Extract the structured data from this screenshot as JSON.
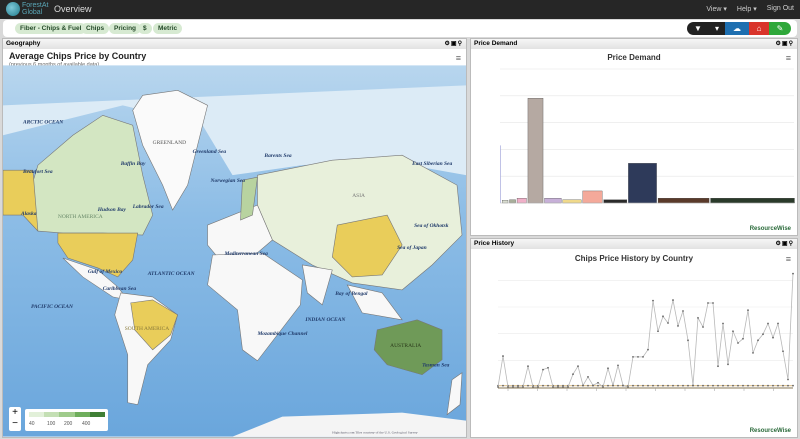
{
  "app": {
    "logo_text": "ForestAt Global",
    "title": "Overview"
  },
  "nav": {
    "view": "View ▾",
    "help": "Help ▾",
    "signout": "Sign Out"
  },
  "filters": [
    "Fiber - Chips & Fuel",
    "Chips",
    "Pricing",
    "$",
    "Metric"
  ],
  "toolbar": {
    "icons": [
      "filter-icon",
      "dropdown-icon",
      "cloud-download-icon",
      "home-icon",
      "pencil-icon"
    ],
    "colors": [
      "#222222",
      "#222222",
      "#1e6fb0",
      "#d9342b",
      "#2fa83a"
    ]
  },
  "geography": {
    "panel_label": "Geography",
    "title": "Average Chips Price by Country",
    "subtitle": "(previous 6 months of available data)",
    "legend": {
      "ticks": [
        "40",
        "100",
        "200",
        "400"
      ],
      "colors": [
        "#e2f0d9",
        "#c4dfb4",
        "#9fcb8b",
        "#6fae5c",
        "#3f7f35"
      ]
    },
    "attribution": "Highcharts.com Tiles courtesy of the U.S. Geological Survey",
    "zoom_in": "+",
    "zoom_out": "−",
    "highlight_colors": {
      "low": "#e9cd5a",
      "mid": "#c9e0b4",
      "high": "#6f9a58"
    },
    "labels": {
      "arctic": "ARCTIC OCEAN",
      "greenland": "GREENLAND",
      "greenland_sea": "Greenland Sea",
      "baffin": "Baffin Bay",
      "barents": "Barents Sea",
      "norwegian": "Norwegian Sea",
      "beaufort": "Beaufort Sea",
      "labrador": "Labrador Sea",
      "hudson": "Hudson Bay",
      "north_america": "NORTH AMERICA",
      "alaska": "Alaska",
      "asia": "ASIA",
      "east_siberian": "East Siberian Sea",
      "okhotsk": "Sea of Okhotsk",
      "japan": "Sea of Japan",
      "atlantic": "ATLANTIC OCEAN",
      "gulf": "Gulf of Mexico",
      "caribbean": "Caribbean Sea",
      "pacific": "PACIFIC OCEAN",
      "south_america": "SOUTH AMERICA",
      "mediterranean": "Mediterranean Sea",
      "bengal": "Bay of Bengal",
      "indian": "INDIAN OCEAN",
      "mozambique": "Mozambique Channel",
      "australia": "AUSTRALIA",
      "tasman": "Tasman Sea"
    }
  },
  "price_demand": {
    "panel_label": "Price Demand",
    "brand": "ResourceWise"
  },
  "price_history": {
    "panel_label": "Price History",
    "brand": "ResourceWise"
  },
  "chart_data": [
    {
      "type": "bar",
      "variant": "variwide",
      "title": "Price Demand",
      "ylim": [
        0,
        5
      ],
      "grid": true,
      "values": [
        2.15,
        0.1,
        0.12,
        0.18,
        3.91,
        0.18,
        0.12,
        0.45,
        0.12,
        1.48,
        0.18,
        0.18
      ],
      "widths": [
        1,
        17,
        18,
        28,
        45,
        50,
        55,
        58,
        69,
        84,
        152,
        250
      ],
      "colors": [
        "#b0b4e0",
        "#d8dccf",
        "#a8ae9a",
        "#f0b0c8",
        "#b5a9a2",
        "#c7b0d8",
        "#f0d98a",
        "#f4a99a",
        "#2a2a2a",
        "#2e3a5a",
        "#5a3a2a",
        "#2a3a2a"
      ]
    },
    {
      "type": "line",
      "title": "Chips Price History by Country",
      "ylim": [
        0,
        4.5
      ],
      "grid": true,
      "series": [
        {
          "color": "#b8b8b8",
          "values": [
            0,
            1.16,
            0,
            0,
            0,
            0,
            0.78,
            0,
            0,
            0.65,
            0.72,
            0,
            0,
            0,
            0,
            0.48,
            0.78,
            0.06,
            0.38,
            0.06,
            0.16,
            0,
            0.7,
            0.06,
            0.81,
            0.06,
            0,
            1.13,
            1.13,
            1.13,
            1.4,
            3.24,
            2.09,
            2.65,
            2.4,
            3.26,
            2.29,
            2.85,
            1.75,
            0.06,
            2.59,
            2.25,
            3.15,
            3.15,
            0.78,
            2.38,
            0.85,
            2.09,
            1.65,
            1.81,
            2.88,
            1.28,
            1.75,
            1.98,
            2.38,
            1.85,
            2.38,
            1.34,
            0.28,
            4.25
          ]
        },
        {
          "color": "#d9b77a",
          "values": [
            0.05,
            0.05,
            0.05,
            0.05,
            0.05,
            0.05,
            0.05,
            0.05,
            0.05,
            0.05,
            0.05,
            0.05,
            0.05,
            0.05,
            0.05,
            0.05,
            0.05,
            0.05,
            0.05,
            0.05,
            0.05,
            0.05,
            0.05,
            0.05,
            0.05,
            0.05,
            0.05,
            0.05,
            0.05,
            0.05,
            0.05,
            0.05,
            0.05,
            0.05,
            0.05,
            0.05,
            0.05,
            0.05,
            0.05,
            0.05,
            0.05,
            0.05,
            0.05,
            0.05,
            0.05,
            0.05,
            0.05,
            0.05,
            0.05,
            0.05,
            0.05,
            0.05,
            0.05,
            0.05,
            0.05,
            0.05,
            0.05,
            0.05,
            0.05,
            0.05
          ]
        }
      ]
    }
  ]
}
